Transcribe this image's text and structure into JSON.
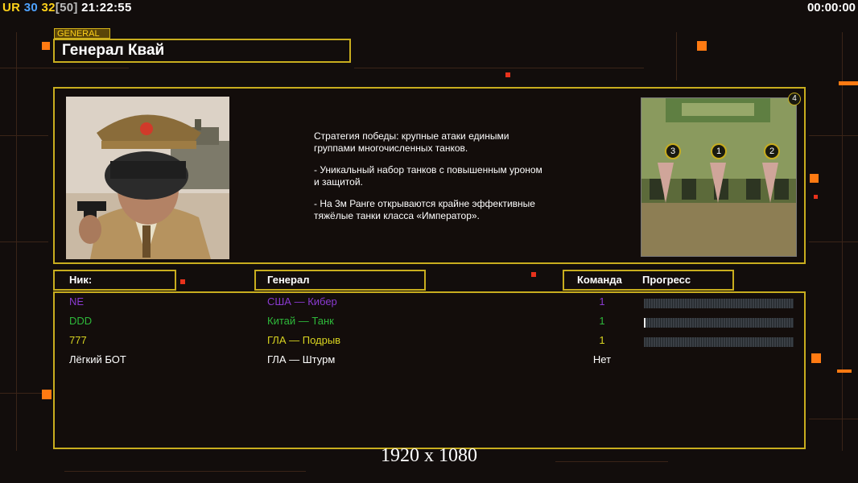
{
  "hud": {
    "ur_label": "UR",
    "ping": "30",
    "fps": "32",
    "fps_max": "[50]",
    "clock": "21:22:55",
    "timer": "00:00:00"
  },
  "general": {
    "tag": "GENERAL",
    "name": "Генерал Квай",
    "description": [
      "Стратегия победы: крупные атаки едиными\n группами многочисленных танков.",
      "- Уникальный набор танков с повышенным уроном\n и защитой.",
      "- На 3м Ранге открываются крайне эффективные\n тяжёлые танки класса «Император»."
    ]
  },
  "map": {
    "player_count_badge": "4",
    "spawns": [
      "3",
      "1",
      "2"
    ]
  },
  "columns": {
    "nick": "Ник:",
    "general": "Генерал",
    "team": "Команда",
    "progress": "Прогресс"
  },
  "players": [
    {
      "nick": "NE",
      "general": "США — Кибер",
      "team": "1",
      "color": "#8a3ad0",
      "progress": 0
    },
    {
      "nick": "DDD",
      "general": "Китай — Танк",
      "team": "1",
      "color": "#2eb83a",
      "progress": 0.01
    },
    {
      "nick": "777",
      "general": "ГЛА — Подрыв",
      "team": "1",
      "color": "#d8d420",
      "progress": 0
    },
    {
      "nick": "Лёгкий БОТ",
      "general": "ГЛА — Штурм",
      "team": "Нет",
      "color": "#ffffff",
      "progress": null
    }
  ],
  "resolution": "1920 x 1080"
}
